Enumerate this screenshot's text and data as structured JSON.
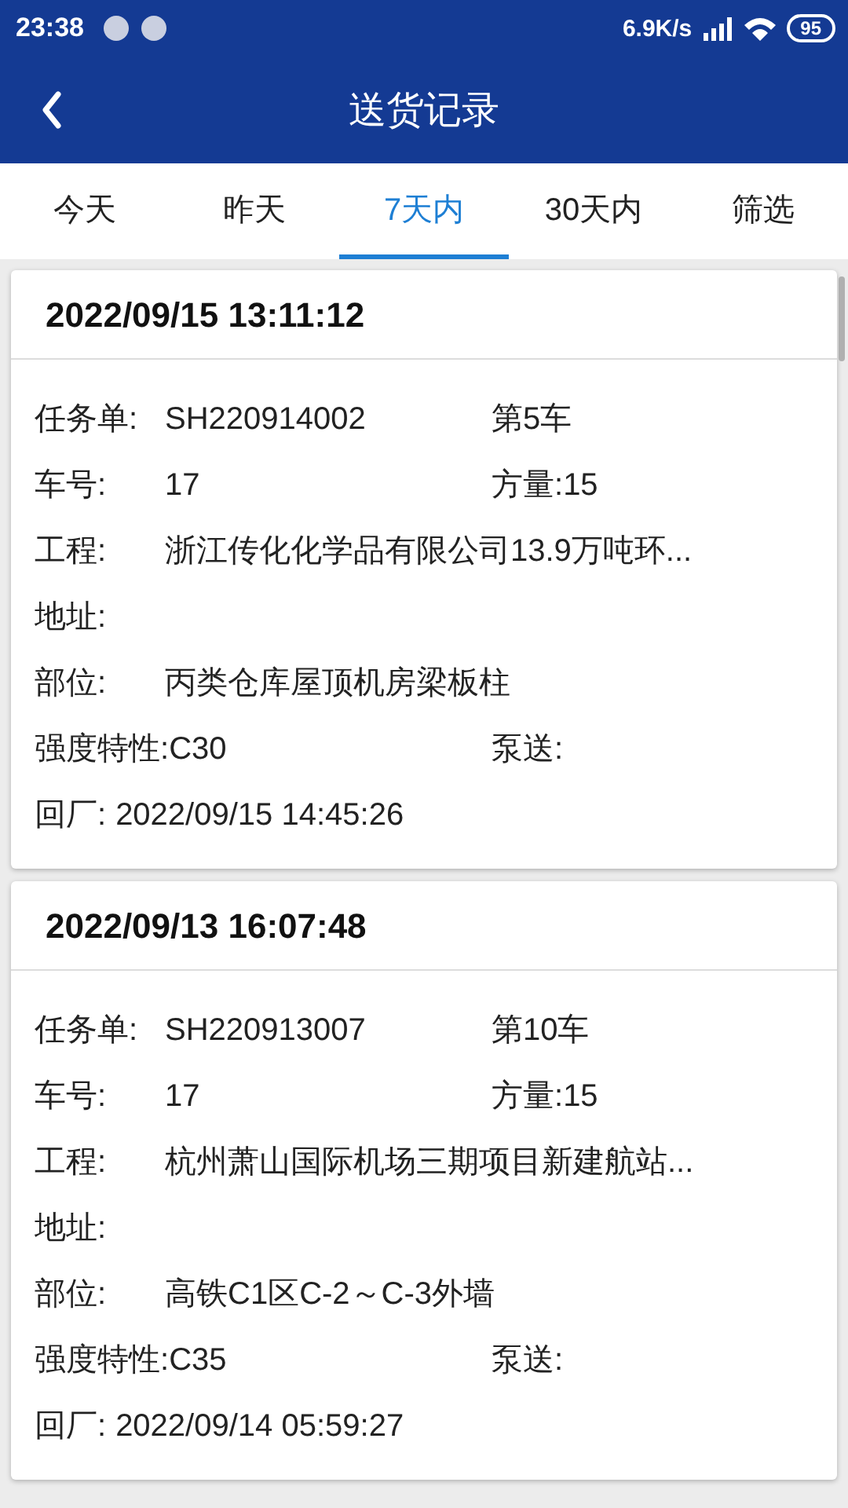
{
  "status_bar": {
    "time": "23:38",
    "speed": "6.9K/s",
    "battery": "95"
  },
  "header": {
    "title": "送货记录"
  },
  "tabs": [
    {
      "label": "今天",
      "selected": false
    },
    {
      "label": "昨天",
      "selected": false
    },
    {
      "label": "7天内",
      "selected": true
    },
    {
      "label": "30天内",
      "selected": false
    },
    {
      "label": "筛选",
      "selected": false
    }
  ],
  "records": [
    {
      "time": "2022/09/15 13:11:12",
      "rows": [
        [
          {
            "kind": "aligned",
            "label": "任务单:",
            "value": "SH220914002"
          },
          {
            "kind": "inline",
            "label": "第5车"
          }
        ],
        [
          {
            "kind": "aligned",
            "label": "车号:",
            "value": "17"
          },
          {
            "kind": "inline",
            "label": "方量:",
            "value": "15"
          }
        ],
        [
          {
            "kind": "aligned",
            "label": "工程:",
            "value": "浙江传化化学品有限公司13.9万吨环..."
          }
        ],
        [
          {
            "kind": "aligned",
            "label": "地址:"
          }
        ],
        [
          {
            "kind": "aligned",
            "label": "部位:",
            "value": "丙类仓库屋顶机房梁板柱"
          }
        ],
        [
          {
            "kind": "aligned",
            "label": "强度特性:",
            "value": "C30"
          },
          {
            "kind": "inline",
            "label": "泵送:"
          }
        ],
        [
          {
            "kind": "inline",
            "label": "回厂:",
            "value": "2022/09/15 14:45:26"
          }
        ]
      ]
    },
    {
      "time": "2022/09/13 16:07:48",
      "rows": [
        [
          {
            "kind": "aligned",
            "label": "任务单:",
            "value": "SH220913007"
          },
          {
            "kind": "inline",
            "label": "第10车"
          }
        ],
        [
          {
            "kind": "aligned",
            "label": "车号:",
            "value": "17"
          },
          {
            "kind": "inline",
            "label": "方量:",
            "value": "15"
          }
        ],
        [
          {
            "kind": "aligned",
            "label": "工程:",
            "value": "杭州萧山国际机场三期项目新建航站..."
          }
        ],
        [
          {
            "kind": "aligned",
            "label": "地址:"
          }
        ],
        [
          {
            "kind": "aligned",
            "label": "部位:",
            "value": "高铁C1区C-2～C-3外墙"
          }
        ],
        [
          {
            "kind": "aligned",
            "label": "强度特性:",
            "value": "C35"
          },
          {
            "kind": "inline",
            "label": "泵送:"
          }
        ],
        [
          {
            "kind": "inline",
            "label": "回厂:",
            "value": "2022/09/14 05:59:27"
          }
        ]
      ]
    }
  ]
}
